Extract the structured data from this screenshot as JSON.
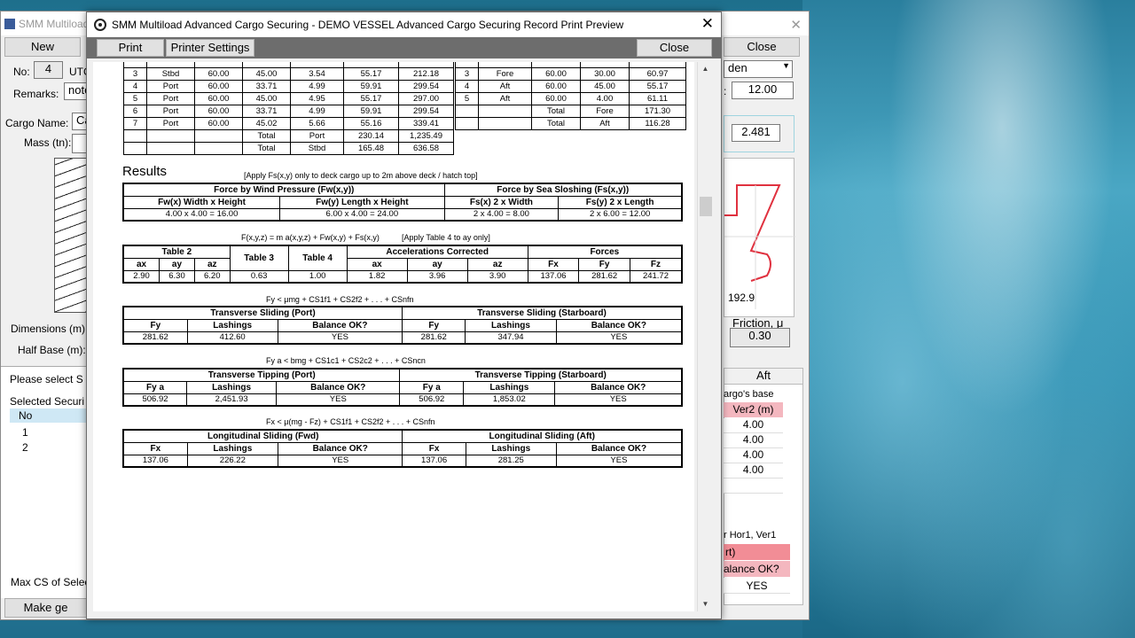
{
  "bg": {
    "title": "SMM Multiload",
    "new_label": "New",
    "close_label": "Close",
    "no_label": "No:",
    "no_value": "4",
    "utc_label": "UTC",
    "remarks_label": "Remarks:",
    "remarks_value": "note",
    "cargo_name_label": "Cargo Name:",
    "cargo_name_value": "Ca",
    "mass_label": "Mass (tn):",
    "dims_label": "Dimensions (m):",
    "halfbase_label": "Half Base (m):",
    "please_select": "Please select S",
    "selected_secur": "Selected Securi",
    "table_no_header": "No",
    "row1": "1",
    "row2": "2",
    "max_cs": "Max CS of Selec",
    "make_btn": "Make ge",
    "combo_value": "den",
    "value_1200": "12.00",
    "value_2481": "2.481",
    "value_1929": "192.9",
    "friction_label": "Friction, μ",
    "friction_value": "0.30",
    "aft_tab": "Aft",
    "cargos_base": "argo's base",
    "ver2_header": "Ver2 (m)",
    "ver2_values": [
      "4.00",
      "4.00",
      "4.00",
      "4.00"
    ],
    "hor_ver_label": "r Hor1, Ver1",
    "rt_label": "rt)",
    "balance_label": "alance OK?",
    "yes_label": "YES"
  },
  "preview": {
    "title": "SMM Multiload Advanced Cargo Securing - DEMO VESSEL Advanced Cargo Securing Record Print Preview",
    "print_label": "Print",
    "printer_settings_label": "Printer Settings",
    "close_label": "Close",
    "lash_rows": [
      [
        "3",
        "Stbd",
        "60.00",
        "45.00",
        "3.54",
        "55.17",
        "212.18"
      ],
      [
        "4",
        "Port",
        "60.00",
        "33.71",
        "4.99",
        "59.91",
        "299.54"
      ],
      [
        "5",
        "Port",
        "60.00",
        "45.00",
        "4.95",
        "55.17",
        "297.00"
      ],
      [
        "6",
        "Port",
        "60.00",
        "33.71",
        "4.99",
        "59.91",
        "299.54"
      ],
      [
        "7",
        "Port",
        "60.00",
        "45.02",
        "5.66",
        "55.16",
        "339.41"
      ]
    ],
    "lash_totals": [
      [
        "Total",
        "Port",
        "230.14",
        "1,235.49"
      ],
      [
        "Total",
        "Stbd",
        "165.48",
        "636.58"
      ]
    ],
    "long_rows": [
      [
        "3",
        "Fore",
        "60.00",
        "30.00",
        "60.97"
      ],
      [
        "4",
        "Aft",
        "60.00",
        "45.00",
        "55.17"
      ],
      [
        "5",
        "Aft",
        "60.00",
        "4.00",
        "61.11"
      ]
    ],
    "long_totals": [
      [
        "Total",
        "Fore",
        "171.30"
      ],
      [
        "Total",
        "Aft",
        "116.28"
      ]
    ],
    "results_title": "Results",
    "results_note": "[Apply Fs(x,y) only to deck cargo up to 2m above deck / hatch top]",
    "wind": {
      "h1": "Force by Wind Pressure (Fw(x,y))",
      "h2": "Force by Sea Sloshing (Fs(x,y))",
      "c1": "Fw(x) Width x Height",
      "c2": "Fw(y) Length x Height",
      "c3": "Fs(x) 2 x Width",
      "c4": "Fs(y) 2 x Length",
      "v1": "4.00 x 4.00 = 16.00",
      "v2": "6.00 x 4.00 = 24.00",
      "v3": "2 x 4.00 = 8.00",
      "v4": "2 x 6.00 = 12.00"
    },
    "formula1": "F(x,y,z) = m a(x,y,z) + Fw(x,y) + Fs(x,y)",
    "formula1b": "[Apply Table 4 to ay only]",
    "acc": {
      "table2": "Table 2",
      "table3": "Table 3",
      "table4": "Table 4",
      "acc_corr": "Accelerations Corrected",
      "forces": "Forces",
      "hdrs": [
        "ax",
        "ay",
        "az",
        "ax",
        "ay",
        "az",
        "Fx",
        "Fy",
        "Fz"
      ],
      "vals": [
        "2.90",
        "6.30",
        "6.20",
        "0.63",
        "1.00",
        "1.82",
        "3.96",
        "3.90",
        "137.06",
        "281.62",
        "241.72"
      ]
    },
    "formula2": "Fy < μmg + CS1f1 + CS2f2 + . . . + CSnfn",
    "ts": {
      "h1": "Transverse Sliding (Port)",
      "h2": "Transverse Sliding (Starboard)",
      "c": [
        "Fy",
        "Lashings",
        "Balance OK?",
        "Fy",
        "Lashings",
        "Balance OK?"
      ],
      "v": [
        "281.62",
        "412.60",
        "YES",
        "281.62",
        "347.94",
        "YES"
      ]
    },
    "formula3": "Fy a < bmg + CS1c1 + CS2c2 + . . . + CSncn",
    "tt": {
      "h1": "Transverse Tipping (Port)",
      "h2": "Transverse Tipping (Starboard)",
      "c": [
        "Fy a",
        "Lashings",
        "Balance OK?",
        "Fy a",
        "Lashings",
        "Balance OK?"
      ],
      "v": [
        "506.92",
        "2,451.93",
        "YES",
        "506.92",
        "1,853.02",
        "YES"
      ]
    },
    "formula4": "Fx < μ(mg - Fz) + CS1f1 + CS2f2 + . . . + CSnfn",
    "ls": {
      "h1": "Longitudinal Sliding (Fwd)",
      "h2": "Longitudinal Sliding (Aft)",
      "c": [
        "Fx",
        "Lashings",
        "Balance OK?",
        "Fx",
        "Lashings",
        "Balance OK?"
      ],
      "v": [
        "137.06",
        "226.22",
        "YES",
        "137.06",
        "281.25",
        "YES"
      ]
    }
  }
}
